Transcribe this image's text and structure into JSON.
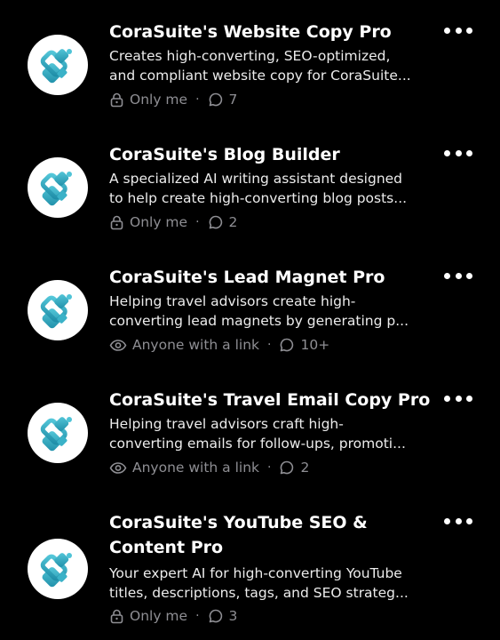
{
  "items": [
    {
      "title": "CoraSuite's Website Copy Pro",
      "desc_line1": "Creates high-converting, SEO-optimized,",
      "desc_line2": "and compliant website copy for CoraSuite...",
      "visibility": "Only me",
      "visibility_icon": "lock-icon",
      "count": "7"
    },
    {
      "title": "CoraSuite's Blog Builder",
      "desc_line1": "A specialized AI writing assistant designed",
      "desc_line2": "to help create high-converting blog posts...",
      "visibility": "Only me",
      "visibility_icon": "lock-icon",
      "count": "2"
    },
    {
      "title": "CoraSuite's Lead Magnet Pro",
      "desc_line1": "Helping travel advisors create high-",
      "desc_line2": "converting lead magnets by generating p...",
      "visibility": "Anyone with a link",
      "visibility_icon": "eye-icon",
      "count": "10+"
    },
    {
      "title": "CoraSuite's Travel Email Copy Pro",
      "desc_line1": "Helping travel advisors craft high-",
      "desc_line2": "converting emails for follow-ups, promoti...",
      "visibility": "Anyone with a link",
      "visibility_icon": "eye-icon",
      "count": "2"
    },
    {
      "title": "CoraSuite's YouTube SEO & Content Pro",
      "desc_line1": "Your expert AI for high-converting YouTube",
      "desc_line2": "titles, descriptions, tags, and SEO strateg...",
      "visibility": "Only me",
      "visibility_icon": "lock-icon",
      "count": "3"
    }
  ],
  "separator": "·",
  "colors": {
    "background": "#000000",
    "title": "#ffffff",
    "meta": "#8e8e93",
    "logo_teal": "#2a9fb8",
    "logo_cyan": "#4ec3d6"
  }
}
